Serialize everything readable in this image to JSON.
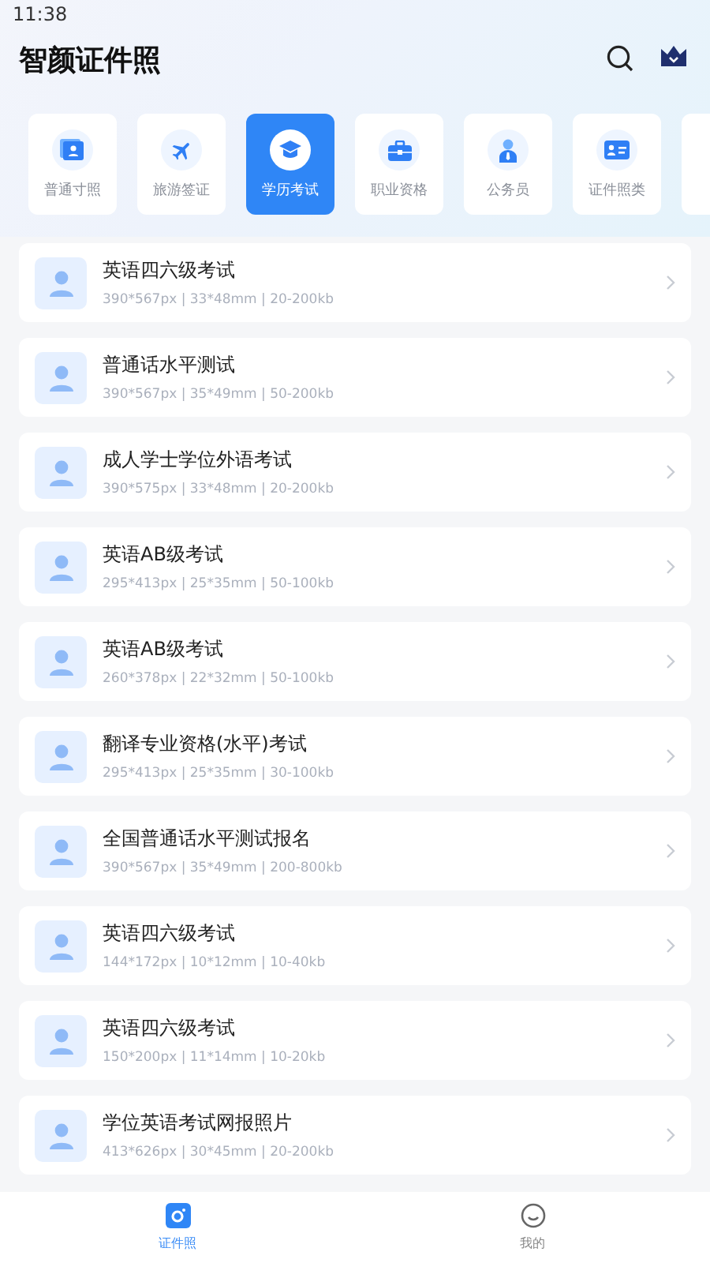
{
  "status_bar": {
    "time": "11:38"
  },
  "header": {
    "title": "智颜证件照"
  },
  "categories": [
    {
      "label": "普通寸照",
      "kind": "portrait",
      "selected": false
    },
    {
      "label": "旅游签证",
      "kind": "plane",
      "selected": false
    },
    {
      "label": "学历考试",
      "kind": "cap",
      "selected": true
    },
    {
      "label": "职业资格",
      "kind": "briefcase",
      "selected": false
    },
    {
      "label": "公务员",
      "kind": "officer",
      "selected": false
    },
    {
      "label": "证件照类",
      "kind": "idcard",
      "selected": false
    }
  ],
  "items": [
    {
      "title": "英语四六级考试",
      "spec": "390*567px | 33*48mm | 20-200kb"
    },
    {
      "title": "普通话水平测试",
      "spec": "390*567px | 35*49mm | 50-200kb"
    },
    {
      "title": "成人学士学位外语考试",
      "spec": "390*575px | 33*48mm | 20-200kb"
    },
    {
      "title": "英语AB级考试",
      "spec": "295*413px | 25*35mm | 50-100kb"
    },
    {
      "title": "英语AB级考试",
      "spec": "260*378px | 22*32mm | 50-100kb"
    },
    {
      "title": "翻译专业资格(水平)考试",
      "spec": "295*413px | 25*35mm | 30-100kb"
    },
    {
      "title": "全国普通话水平测试报名",
      "spec": "390*567px | 35*49mm | 200-800kb"
    },
    {
      "title": "英语四六级考试",
      "spec": "144*172px | 10*12mm | 10-40kb"
    },
    {
      "title": "英语四六级考试",
      "spec": "150*200px | 11*14mm | 10-20kb"
    },
    {
      "title": "学位英语考试网报照片",
      "spec": "413*626px | 30*45mm | 20-200kb"
    }
  ],
  "tabbar": [
    {
      "label": "证件照",
      "kind": "camera",
      "selected": true
    },
    {
      "label": "我的",
      "kind": "smile",
      "selected": false
    }
  ]
}
